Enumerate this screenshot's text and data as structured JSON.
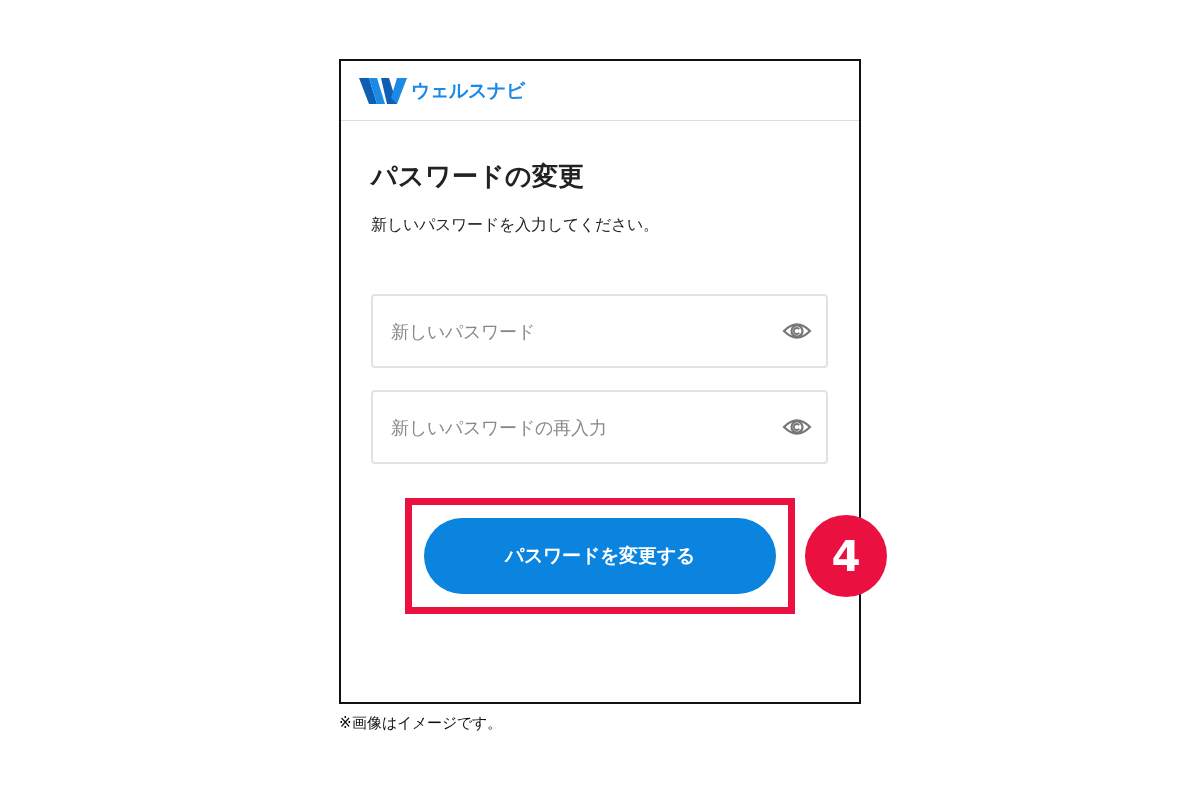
{
  "header": {
    "brand": "ウェルスナビ"
  },
  "title": "パスワードの変更",
  "description": "新しいパスワードを入力してください。",
  "fields": [
    {
      "placeholder": "新しいパスワード"
    },
    {
      "placeholder": "新しいパスワードの再入力"
    }
  ],
  "submit_button": "パスワードを変更する",
  "annotation": {
    "step": "4"
  },
  "note": "※画像はイメージです。"
}
